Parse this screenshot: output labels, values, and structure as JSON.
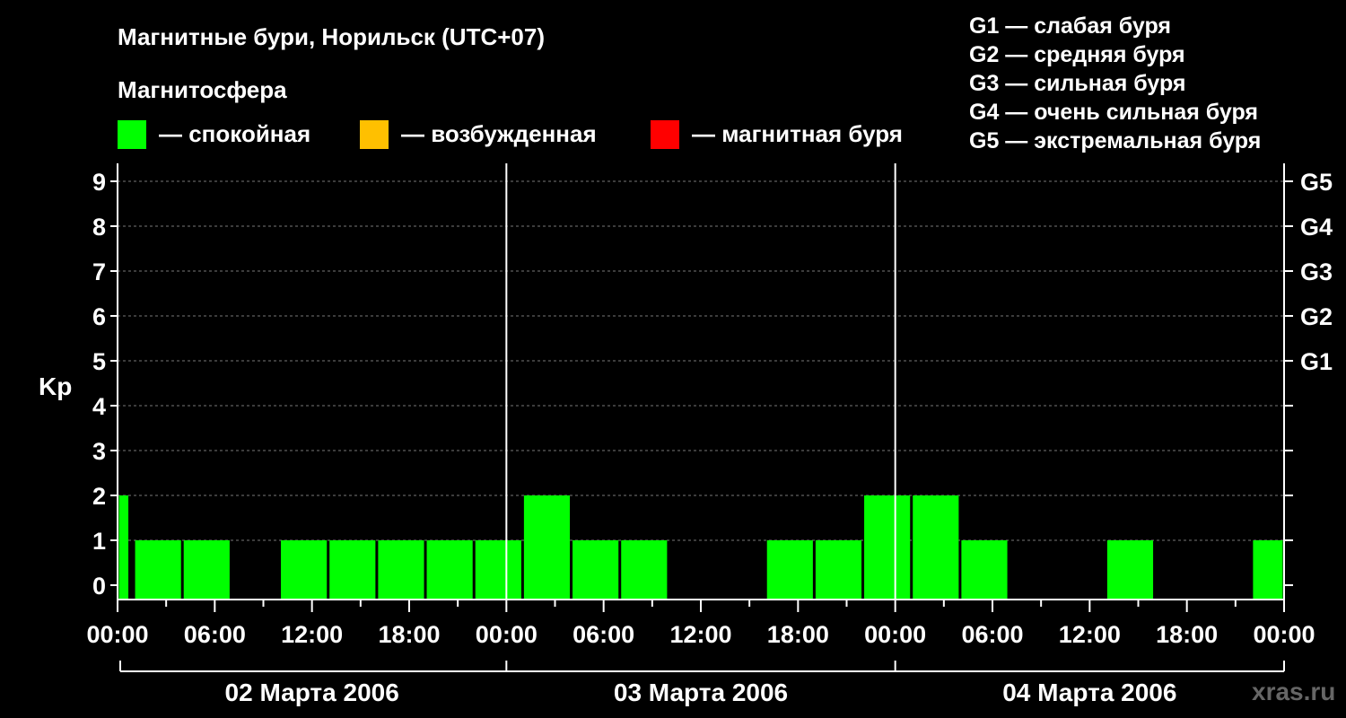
{
  "title": "Магнитные бури, Норильск (UTC+07)",
  "magnetosphere_label": "Магнитосфера",
  "state_legend": [
    {
      "label": "— спокойная",
      "color": "#00ff00"
    },
    {
      "label": "— возбужденная",
      "color": "#ffc000"
    },
    {
      "label": "— магнитная буря",
      "color": "#ff0000"
    }
  ],
  "storm_levels": [
    "G1 — слабая буря",
    "G2 — средняя буря",
    "G3 — сильная буря",
    "G4 — очень сильная буря",
    "G5 — экстремальная буря"
  ],
  "watermark": "xras.ru",
  "chart_data": {
    "type": "bar",
    "ylabel": "Kp",
    "ylim": [
      0,
      9
    ],
    "y_ticks": [
      "0",
      "1",
      "2",
      "3",
      "4",
      "5",
      "6",
      "7",
      "8",
      "9"
    ],
    "right_ticks": [
      {
        "y": 5,
        "label": "G1"
      },
      {
        "y": 6,
        "label": "G2"
      },
      {
        "y": 7,
        "label": "G3"
      },
      {
        "y": 8,
        "label": "G4"
      },
      {
        "y": 9,
        "label": "G5"
      }
    ],
    "x_hours_range": [
      0,
      72
    ],
    "x_ticks": [
      "00:00",
      "06:00",
      "12:00",
      "18:00",
      "00:00",
      "06:00",
      "12:00",
      "18:00",
      "00:00",
      "06:00",
      "12:00",
      "18:00",
      "00:00"
    ],
    "days": [
      "02 Марта 2006",
      "03 Марта 2006",
      "04 Марта 2006"
    ],
    "grid": true,
    "bars": [
      {
        "start": 0,
        "end": 0.75,
        "kp": 2,
        "color": "#00ff00"
      },
      {
        "start": 1,
        "end": 4,
        "kp": 1,
        "color": "#00ff00"
      },
      {
        "start": 4,
        "end": 7,
        "kp": 1,
        "color": "#00ff00"
      },
      {
        "start": 7,
        "end": 10,
        "kp": 0,
        "color": "#00ff00"
      },
      {
        "start": 10,
        "end": 13,
        "kp": 1,
        "color": "#00ff00"
      },
      {
        "start": 13,
        "end": 16,
        "kp": 1,
        "color": "#00ff00"
      },
      {
        "start": 16,
        "end": 19,
        "kp": 1,
        "color": "#00ff00"
      },
      {
        "start": 19,
        "end": 22,
        "kp": 1,
        "color": "#00ff00"
      },
      {
        "start": 22,
        "end": 25,
        "kp": 1,
        "color": "#00ff00"
      },
      {
        "start": 25,
        "end": 28,
        "kp": 2,
        "color": "#00ff00"
      },
      {
        "start": 28,
        "end": 31,
        "kp": 1,
        "color": "#00ff00"
      },
      {
        "start": 31,
        "end": 34,
        "kp": 1,
        "color": "#00ff00"
      },
      {
        "start": 34,
        "end": 37,
        "kp": 0,
        "color": "#00ff00"
      },
      {
        "start": 37,
        "end": 40,
        "kp": 0,
        "color": "#00ff00"
      },
      {
        "start": 40,
        "end": 43,
        "kp": 1,
        "color": "#00ff00"
      },
      {
        "start": 43,
        "end": 46,
        "kp": 1,
        "color": "#00ff00"
      },
      {
        "start": 46,
        "end": 49,
        "kp": 2,
        "color": "#00ff00"
      },
      {
        "start": 49,
        "end": 52,
        "kp": 2,
        "color": "#00ff00"
      },
      {
        "start": 52,
        "end": 55,
        "kp": 1,
        "color": "#00ff00"
      },
      {
        "start": 55,
        "end": 58,
        "kp": 0,
        "color": "#00ff00"
      },
      {
        "start": 58,
        "end": 61,
        "kp": 0,
        "color": "#00ff00"
      },
      {
        "start": 61,
        "end": 64,
        "kp": 1,
        "color": "#00ff00"
      },
      {
        "start": 64,
        "end": 67,
        "kp": 0,
        "color": "#00ff00"
      },
      {
        "start": 67,
        "end": 70,
        "kp": 0,
        "color": "#00ff00"
      },
      {
        "start": 70,
        "end": 72,
        "kp": 1,
        "color": "#00ff00"
      }
    ]
  }
}
